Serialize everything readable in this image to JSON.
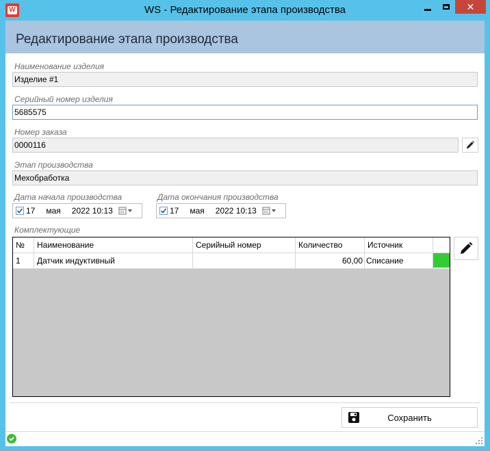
{
  "window": {
    "title": "WS - Редактирование этапа производства",
    "close_label": "✕"
  },
  "header": {
    "title": "Редактирование этапа производства"
  },
  "product_name": {
    "label": "Наименование изделия",
    "value": "Изделие #1"
  },
  "serial_number": {
    "label": "Серийный номер изделия",
    "value": "5685575"
  },
  "order_number": {
    "label": "Номер заказа",
    "value": "0000116"
  },
  "stage": {
    "label": "Этап производства",
    "value": "Мехобработка"
  },
  "start_date": {
    "label": "Дата начала производства",
    "day": "17",
    "month": "мая",
    "year_time": "2022 10:13",
    "checked": true
  },
  "end_date": {
    "label": "Дата окончания производства",
    "day": "17",
    "month": "мая",
    "year_time": "2022 10:13",
    "checked": true
  },
  "components": {
    "label": "Комплектующие",
    "columns": [
      "№",
      "Наименование",
      "Серийный номер",
      "Количество",
      "Источник",
      ""
    ],
    "rows": [
      {
        "num": "1",
        "name": "Датчик индуктивный",
        "serial": "",
        "qty": "60,00",
        "source": "Списание",
        "status_color": "#33cc33"
      }
    ]
  },
  "actions": {
    "save_label": "Сохранить"
  },
  "colors": {
    "title_bar": "#56c2ea",
    "header_band": "#aac5e0",
    "close_button": "#c7463a",
    "status_ok": "#3cbd3c"
  }
}
